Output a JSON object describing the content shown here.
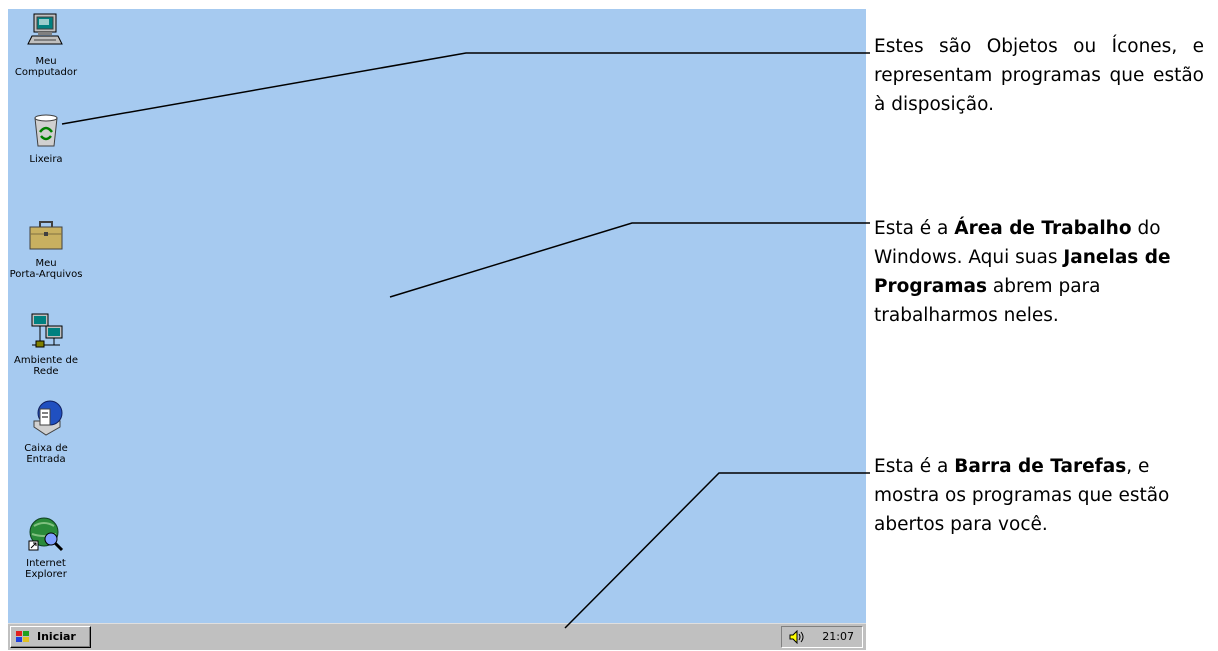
{
  "desktop": {
    "background": "#a6caf0",
    "icons": [
      {
        "label": "Meu\nComputador",
        "icon": "computer-icon"
      },
      {
        "label": "Lixeira",
        "icon": "recycle-bin-icon"
      },
      {
        "label": "Meu\nPorta-Arquivos",
        "icon": "briefcase-icon"
      },
      {
        "label": "Ambiente de\nRede",
        "icon": "network-icon"
      },
      {
        "label": "Caixa de\nEntrada",
        "icon": "inbox-icon"
      },
      {
        "label": "Internet\nExplorer",
        "icon": "internet-explorer-icon"
      }
    ]
  },
  "taskbar": {
    "start_label": "Iniciar",
    "clock": "21:07",
    "tray_icon": "speaker-icon"
  },
  "annotations": [
    {
      "text": "Estes são Objetos ou Ícones, e representam programas que estão à disposição."
    },
    {
      "t1": "Esta é a ",
      "b1": "Área de Trabalho",
      "t2": " do Windows. Aqui suas ",
      "b2": "Janelas de Programas",
      "t3": " abrem para trabalharmos neles."
    },
    {
      "t1": "Esta é a ",
      "b1": "Barra de Tarefas",
      "t2": ", e mostra os programas que estão abertos para você."
    }
  ]
}
